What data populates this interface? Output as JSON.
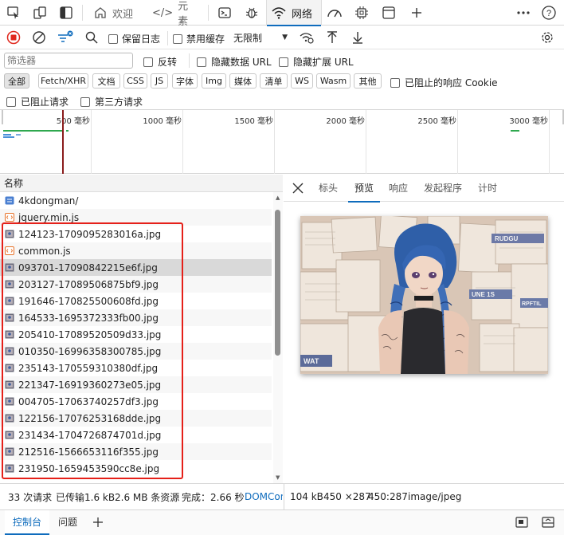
{
  "panel_tabs": {
    "welcome": "欢迎",
    "elements": "元素",
    "network": "网络"
  },
  "toolbar": {
    "preserve_log": "保留日志",
    "disable_cache": "禁用缓存",
    "throttle": "无限制"
  },
  "filter": {
    "placeholder": "筛选器",
    "invert": "反转",
    "hide_data_urls": "隐藏数据 URL",
    "hide_extension_urls": "隐藏扩展 URL",
    "types": [
      "全部",
      "Fetch/XHR",
      "文档",
      "CSS",
      "JS",
      "字体",
      "Img",
      "媒体",
      "清单",
      "WS",
      "Wasm",
      "其他"
    ],
    "blocked_response_cookies": "已阻止的响应 Cookie",
    "blocked_requests": "已阻止请求",
    "third_party": "第三方请求"
  },
  "timeline": {
    "ticks": [
      "500 毫秒",
      "1000 毫秒",
      "1500 毫秒",
      "2000 毫秒",
      "2500 毫秒",
      "3000 毫秒"
    ]
  },
  "request_list": {
    "header": "名称",
    "requests": [
      {
        "name": "4kdongman/",
        "type": "doc"
      },
      {
        "name": "jquery.min.js",
        "type": "script"
      },
      {
        "name": "124123-1709095283016a.jpg",
        "type": "img"
      },
      {
        "name": "common.js",
        "type": "script"
      },
      {
        "name": "093701-17090842215e6f.jpg",
        "type": "img"
      },
      {
        "name": "203127-17089506875bf9.jpg",
        "type": "img"
      },
      {
        "name": "191646-170825500608fd.jpg",
        "type": "img"
      },
      {
        "name": "164533-1695372333fb00.jpg",
        "type": "img"
      },
      {
        "name": "205410-17089520509d33.jpg",
        "type": "img"
      },
      {
        "name": "010350-16996358300785.jpg",
        "type": "img"
      },
      {
        "name": "235143-170559310380df.jpg",
        "type": "img"
      },
      {
        "name": "221347-16919360273e05.jpg",
        "type": "img"
      },
      {
        "name": "004705-17063740257df3.jpg",
        "type": "img"
      },
      {
        "name": "122156-17076253168dde.jpg",
        "type": "img"
      },
      {
        "name": "231434-1704726874701d.jpg",
        "type": "img"
      },
      {
        "name": "212516-1566653116f355.jpg",
        "type": "img"
      },
      {
        "name": "231950-1659453590cc8e.jpg",
        "type": "img"
      }
    ]
  },
  "details": {
    "tabs": [
      "标头",
      "预览",
      "响应",
      "发起程序",
      "计时"
    ],
    "active_tab": "预览"
  },
  "status_bar": {
    "requests": "33 次请求",
    "transferred": "已传输1.6 kB",
    "resources": "2.6 MB 条资源",
    "finish": "完成：2.66 秒",
    "domcontent": "DOMCon",
    "img_size": "104 kB",
    "dimensions": "450 ×287",
    "ratio": "450:287",
    "mime": "image/jpeg"
  },
  "drawer": {
    "console": "控制台",
    "issues": "问题"
  },
  "preview_image": {
    "text_1": "RUDGU",
    "text_2": "UNE 1S",
    "text_3": "RPFTIL",
    "text_4": "WAT"
  },
  "colors": {
    "accent": "#0f6cbd",
    "record_red": "#e0281d",
    "highlight_box": "#e52019",
    "hair_blue": "#3f6fb8"
  }
}
